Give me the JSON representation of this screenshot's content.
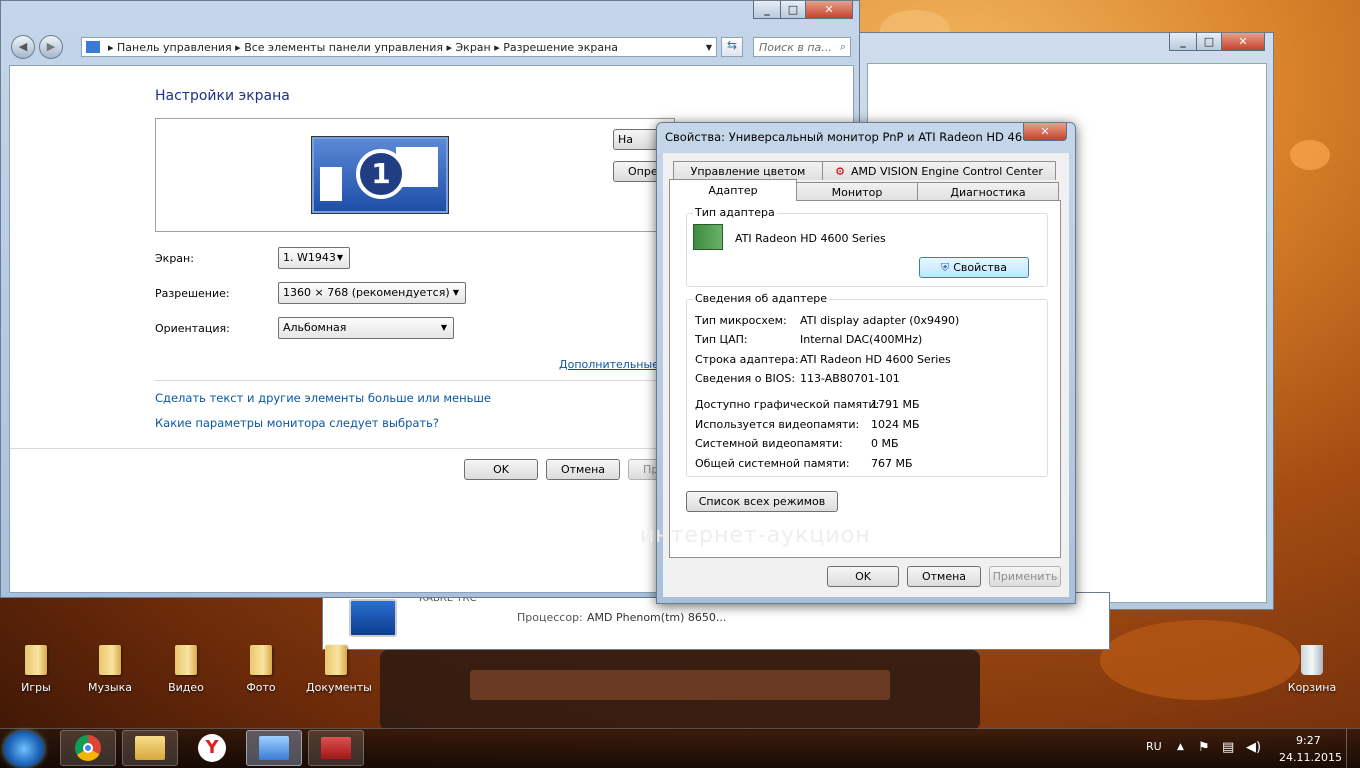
{
  "cp_window": {
    "breadcrumb": [
      "Панель управления",
      "Все элементы панели управления",
      "Экран",
      "Разрешение экрана"
    ],
    "search_placeholder": "Поиск в па...",
    "heading": "Настройки экрана",
    "monitor_number": "1",
    "btn_find_partial": "На",
    "btn_detect_partial": "Опре",
    "screen_label": "Экран:",
    "screen_value": "1. W1943",
    "resolution_label": "Разрешение:",
    "resolution_value": "1360 × 768 (рекомендуется)",
    "orientation_label": "Ориентация:",
    "orientation_value": "Альбомная",
    "advanced_link": "Дополнительные",
    "link_text_size": "Сделать текст и другие элементы больше или меньше",
    "link_monitor_params": "Какие параметры монитора следует выбрать?",
    "ok": "OK",
    "cancel": "Отмена",
    "apply_partial": "Пр"
  },
  "back_window": {
    "processor_label": "Процессор:",
    "processor_value": "AMD Phenom(tm) 8650...",
    "partial_text": "КАБКЕ ТКС"
  },
  "dialog": {
    "title": "Свойства: Универсальный монитор PnP и ATI Radeon HD 4600 ...",
    "tabs_top": [
      "Управление цветом",
      "AMD VISION Engine Control Center"
    ],
    "tabs_bottom": [
      "Адаптер",
      "Монитор",
      "Диагностика"
    ],
    "adapter_type_group": "Тип адаптера",
    "adapter_name": "ATI Radeon HD 4600 Series",
    "properties_btn": "Свойства",
    "info_group": "Сведения об адаптере",
    "info_rows": [
      {
        "label": "Тип микросхем:",
        "value": "ATI display adapter (0x9490)"
      },
      {
        "label": "Тип ЦАП:",
        "value": "Internal DAC(400MHz)"
      },
      {
        "label": "Строка адаптера:",
        "value": "ATI Radeon HD 4600 Series"
      },
      {
        "label": "Сведения о BIOS:",
        "value": "113-AB80701-101"
      }
    ],
    "mem_rows": [
      {
        "label": "Доступно графической памяти:",
        "value": "1791 МБ"
      },
      {
        "label": "Используется видеопамяти:",
        "value": "1024 МБ"
      },
      {
        "label": "Системной видеопамяти:",
        "value": "0 МБ"
      },
      {
        "label": "Общей системной памяти:",
        "value": "767 МБ"
      }
    ],
    "list_modes_btn": "Список всех режимов",
    "ok": "OK",
    "cancel": "Отмена",
    "apply": "Применить"
  },
  "desktop_icons": [
    "Игры",
    "Музыка",
    "Видео",
    "Фото",
    "Документы"
  ],
  "recycle_bin": "Корзина",
  "watermark": "интернет-аукцион",
  "taskbar": {
    "lang": "RU",
    "time": "9:27",
    "date": "24.11.2015"
  }
}
